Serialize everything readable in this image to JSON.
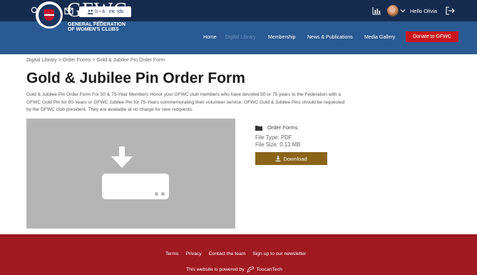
{
  "topbar": {
    "invite_label": "Invite friends",
    "greeting": "Hello Olivia",
    "icons": [
      "search-icon",
      "bell-icon",
      "mail-icon",
      "chart-icon",
      "logout-icon"
    ]
  },
  "brand": {
    "name": "GFWC",
    "est": "est. 1890",
    "line2": "GENERAL FEDERATION",
    "line3": "OF WOMEN'S CLUBS",
    "colors": {
      "navy": "#162c4f",
      "blue": "#2a5a93",
      "red": "#c8161d",
      "gold": "#8a6418",
      "footer": "#a01a21"
    }
  },
  "nav": {
    "items": [
      "Home",
      "Digital Library",
      "Membership",
      "News & Publications",
      "Media Gallery"
    ],
    "active": "Digital Library",
    "donate_label": "Donate to GFWC"
  },
  "breadcrumb": "Digital Library > Order Forms > Gold & Jubilee Pin Order Form",
  "page": {
    "title": "Gold & Jubilee Pin Order Form",
    "description": "Gold & Jubilee Pin Order Form For 50 & 75-Year Members Honor your GFWC club members who have devoted 50 or 75 years to the Federation with a GFWC Gold Pin for 50-Years or GFWC Jubilee Pin for 75-Years commemorating their volunteer service. GFWC Gold & Jubilee Pins should be requested by the GFWC club president. They are available at no charge for new recipients."
  },
  "file": {
    "category": "Order Forms",
    "type_text": "File Type: PDF",
    "size_text": "File Size: 0.13 MB",
    "download_label": "Download"
  },
  "footer": {
    "links": [
      "Terms",
      "Privacy",
      "Contact the team",
      "Sign up to our newsletter"
    ],
    "powered_prefix": "This website is powered by",
    "powered_brand": "ToucanTech"
  }
}
